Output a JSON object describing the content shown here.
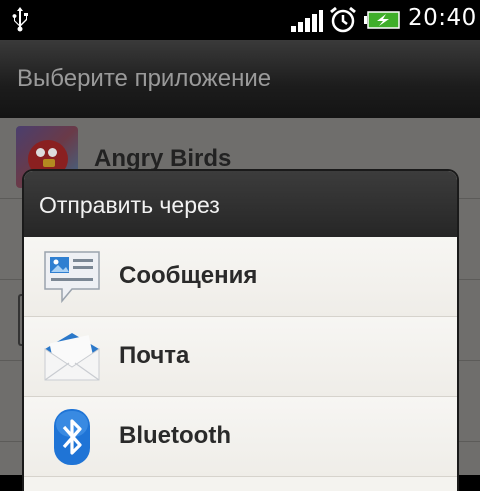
{
  "status_bar": {
    "time": "20:40",
    "icons": [
      "usb-icon",
      "signal-icon",
      "alarm-icon",
      "battery-charging-icon"
    ]
  },
  "chooser": {
    "title": "Выберите приложение",
    "items": [
      {
        "label": "Angry Birds",
        "icon": "angry-birds-icon"
      }
    ]
  },
  "share_dialog": {
    "title": "Отправить через",
    "items": [
      {
        "label": "Сообщения",
        "icon": "messages-icon"
      },
      {
        "label": "Почта",
        "icon": "mail-icon"
      },
      {
        "label": "Bluetooth",
        "icon": "bluetooth-icon"
      }
    ]
  }
}
